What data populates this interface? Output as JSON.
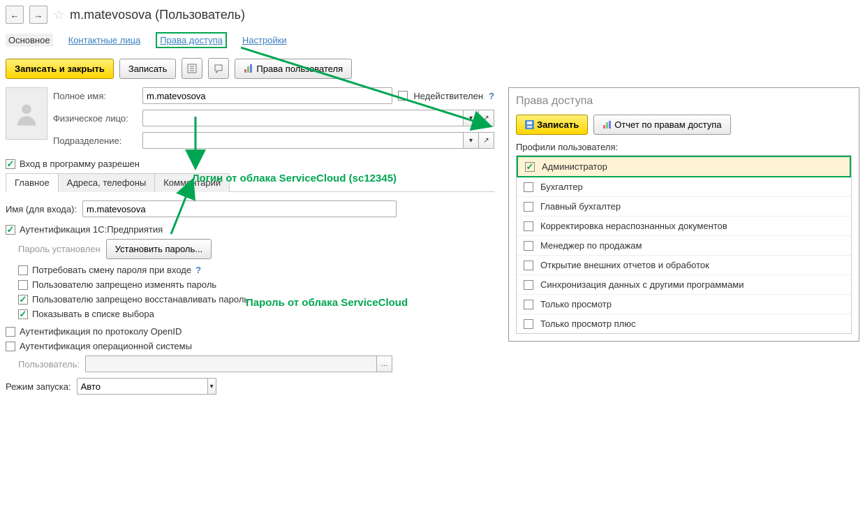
{
  "header": {
    "title": "m.matevosova (Пользователь)"
  },
  "mainTabs": {
    "t0": "Основное",
    "t1": "Контактные лица",
    "t2": "Права доступа",
    "t3": "Настройки"
  },
  "toolbar": {
    "saveClose": "Записать и закрыть",
    "save": "Записать",
    "userRights": "Права пользователя"
  },
  "form": {
    "fullNameLabel": "Полное имя:",
    "fullNameValue": "m.matevosova",
    "invalidLabel": "Недействителен",
    "phys": "Физическое лицо:",
    "dept": "Подразделение:",
    "loginAllowed": "Вход в программу разрешен"
  },
  "innerTabs": {
    "t0": "Главное",
    "t1": "Адреса, телефоны",
    "t2": "Комментарий"
  },
  "login": {
    "nameLabel": "Имя (для входа):",
    "nameValue": "m.matevosova",
    "auth1c": "Аутентификация 1С:Предприятия",
    "pwdSet": "Пароль установлен",
    "setPwdBtn": "Установить пароль...",
    "reqChange": "Потребовать смену пароля при входе",
    "forbidChange": "Пользователю запрещено изменять пароль",
    "forbidRestore": "Пользователю запрещено восстанавливать пароль",
    "showInList": "Показывать в списке выбора",
    "authOpenId": "Аутентификация по протоколу OpenID",
    "authOS": "Аутентификация операционной системы",
    "userLabel": "Пользователь:",
    "modeLabel": "Режим запуска:",
    "modeValue": "Авто"
  },
  "rights": {
    "title": "Права доступа",
    "save": "Записать",
    "report": "Отчет по правам доступа",
    "profilesLabel": "Профили пользователя:",
    "profiles": [
      {
        "label": "Администратор",
        "checked": true
      },
      {
        "label": "Бухгалтер",
        "checked": false
      },
      {
        "label": "Главный бухгалтер",
        "checked": false
      },
      {
        "label": "Корректировка нераспознанных документов",
        "checked": false
      },
      {
        "label": "Менеджер по продажам",
        "checked": false
      },
      {
        "label": "Открытие внешних отчетов и обработок",
        "checked": false
      },
      {
        "label": "Синхронизация данных с другими программами",
        "checked": false
      },
      {
        "label": "Только просмотр",
        "checked": false
      },
      {
        "label": "Только просмотр плюс",
        "checked": false
      }
    ]
  },
  "annotations": {
    "login": "Логин от облака ServiceCloud (sc12345)",
    "password": "Пароль от облака ServiceCloud"
  }
}
